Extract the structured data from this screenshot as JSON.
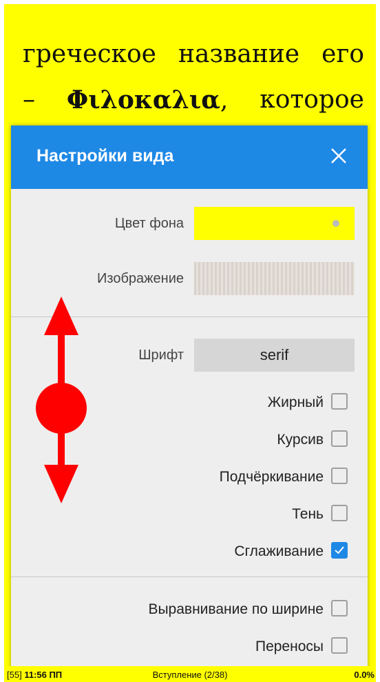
{
  "reader": {
    "line1_words": [
      "греческое",
      "название",
      "его"
    ],
    "line2_dash": "–",
    "line2_bold": "Φιλοκαλια",
    "line2_comma": ",",
    "line2_word": "которое"
  },
  "dialog": {
    "title": "Настройки вида",
    "bg_color_label": "Цвет фона",
    "bg_color_value": "#ffff00",
    "image_label": "Изображение",
    "font_label": "Шрифт",
    "font_value": "serif",
    "checkboxes": [
      {
        "label": "Жирный",
        "checked": false
      },
      {
        "label": "Курсив",
        "checked": false
      },
      {
        "label": "Подчёркивание",
        "checked": false
      },
      {
        "label": "Тень",
        "checked": false
      },
      {
        "label": "Сглаживание",
        "checked": true
      }
    ],
    "checkboxes2": [
      {
        "label": "Выравнивание по ширине",
        "checked": false
      },
      {
        "label": "Переносы",
        "checked": false
      }
    ]
  },
  "status": {
    "page": "[55]",
    "time": "11:56 ПП",
    "chapter": "Вступление (2/38)",
    "progress": "0.0%"
  },
  "colors": {
    "accent": "#1e88e5",
    "page_background": "#ffff00",
    "gesture": "#ff0000"
  },
  "icons": [
    "close-icon",
    "checkmark-icon",
    "scroll-gesture-icon"
  ]
}
